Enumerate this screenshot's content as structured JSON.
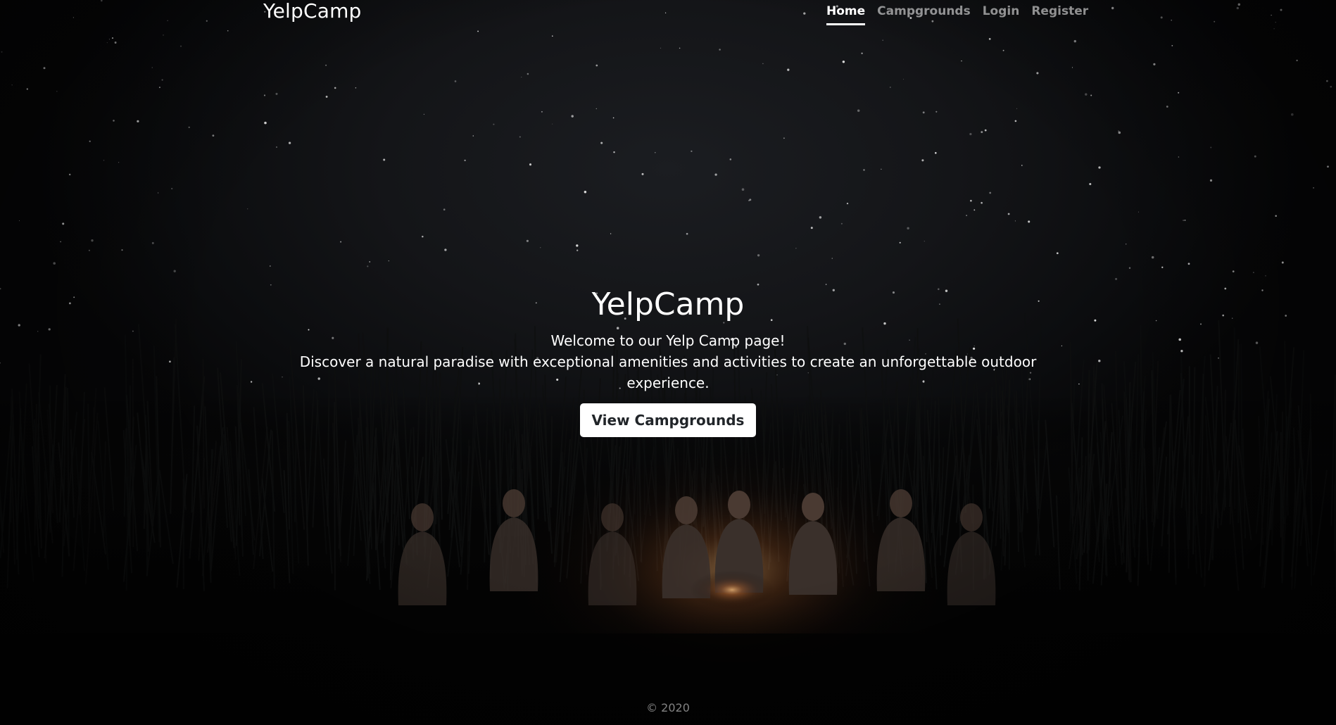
{
  "header": {
    "brand": "YelpCamp",
    "nav": [
      {
        "label": "Home",
        "active": true
      },
      {
        "label": "Campgrounds",
        "active": false
      },
      {
        "label": "Login",
        "active": false
      },
      {
        "label": "Register",
        "active": false
      }
    ]
  },
  "hero": {
    "title": "YelpCamp",
    "lead_1": "Welcome to our Yelp Camp page!",
    "lead_2": "Discover a natural paradise with exceptional amenities and activities to create an unforgettable outdoor experience.",
    "button_label": "View Campgrounds"
  },
  "footer": {
    "copyright": "© 2020"
  },
  "colors": {
    "background": "#121316",
    "text": "#ffffff",
    "nav_inactive": "#8c8c8c",
    "button_bg": "#ffffff",
    "button_text": "#212529"
  }
}
